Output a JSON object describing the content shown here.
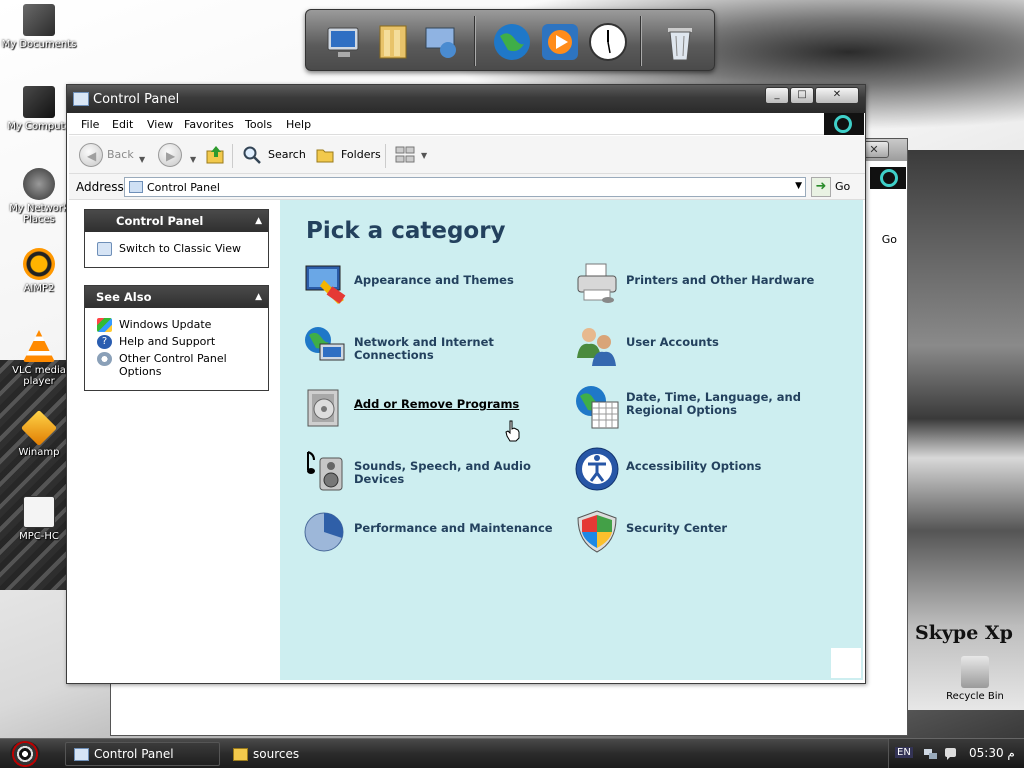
{
  "desktop": {
    "icons": [
      {
        "label": "My Documents"
      },
      {
        "label": "My Compute"
      },
      {
        "label": "My Network Places"
      },
      {
        "label": "AIMP2"
      },
      {
        "label": "VLC media player"
      },
      {
        "label": "Winamp"
      },
      {
        "label": "MPC-HC"
      }
    ],
    "brand_text": "Skype Xp",
    "recycle_bin": "Recycle Bin"
  },
  "dock": {
    "items": [
      "computer-icon",
      "documents-icon",
      "network-icon",
      "globe-icon",
      "media-player-icon",
      "clock-icon",
      "trash-icon"
    ]
  },
  "background_window": {
    "close_glyph": "✕",
    "go_label": "Go"
  },
  "window": {
    "title": "Control Panel",
    "buttons": {
      "minimize": "_",
      "maximize": "□",
      "close": "✕"
    },
    "menu": [
      "File",
      "Edit",
      "View",
      "Favorites",
      "Tools",
      "Help"
    ],
    "toolbar": {
      "back": "Back",
      "search": "Search",
      "folders": "Folders"
    },
    "address": {
      "label": "Address",
      "value": "Control Panel",
      "go": "Go"
    }
  },
  "task_pane": {
    "control_panel": {
      "title": "Control Panel",
      "links": [
        "Switch to Classic View"
      ]
    },
    "see_also": {
      "title": "See Also",
      "links": [
        "Windows Update",
        "Help and Support",
        "Other Control Panel Options"
      ]
    }
  },
  "content": {
    "heading": "Pick a category",
    "categories_left": [
      "Appearance and Themes",
      "Network and Internet Connections",
      "Add or Remove Programs",
      "Sounds, Speech, and Audio Devices",
      "Performance and Maintenance"
    ],
    "categories_right": [
      "Printers and Other Hardware",
      "User Accounts",
      "Date, Time, Language, and Regional Options",
      "Accessibility Options",
      "Security Center"
    ]
  },
  "taskbar": {
    "buttons": [
      "Control Panel",
      "sources"
    ],
    "language": "EN",
    "clock": "05:30 م"
  },
  "colors": {
    "content_bg": "#cdeef0",
    "category_text": "#23415e",
    "titlebar": "#3a3a3a"
  }
}
